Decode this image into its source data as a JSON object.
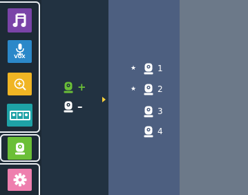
{
  "sidebar": {
    "vox_label": "VOX"
  },
  "actions": {
    "add_sign": "+",
    "remove_sign": "–"
  },
  "cameras": [
    {
      "number": "1",
      "star": "★"
    },
    {
      "number": "2",
      "star": "★"
    },
    {
      "number": "3",
      "star": ""
    },
    {
      "number": "4",
      "star": ""
    }
  ],
  "colors": {
    "music_tile": "#7a44a8",
    "vox_tile": "#2b88c9",
    "zoom_tile": "#f0b524",
    "monitor_tile": "#1ea2a6",
    "camera_tile": "#6bbf37",
    "settings_tile": "#ee7fae",
    "pointer": "#ffd43b"
  },
  "icons": [
    "music-note-icon",
    "microphone-icon",
    "zoom-in-icon",
    "multi-camera-icon",
    "camera-icon",
    "gear-icon"
  ]
}
